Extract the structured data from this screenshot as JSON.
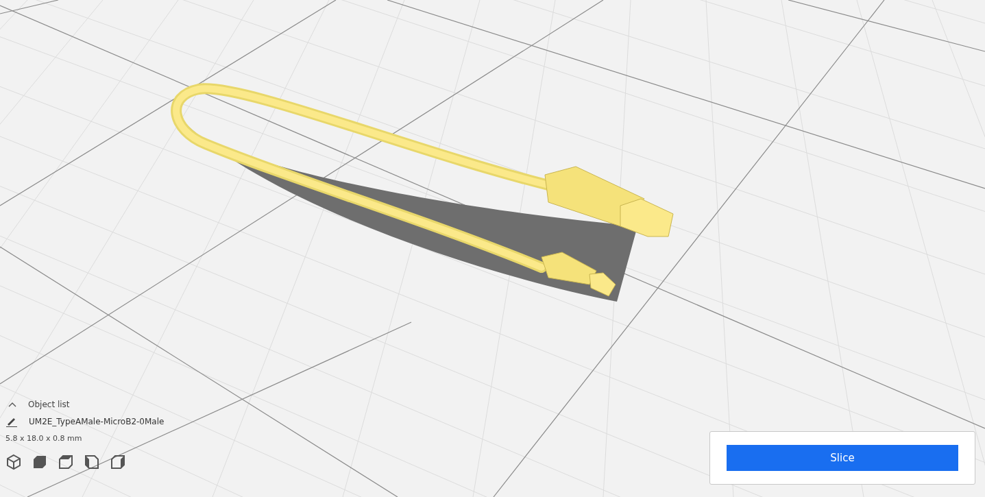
{
  "object_list": {
    "title": "Object list",
    "expanded": false,
    "object_name": "UM2E_TypeAMale-MicroB2-0Male",
    "dimensions": "5.8 x 18.0 x 0.8 mm"
  },
  "slice_button": {
    "label": "Slice"
  }
}
